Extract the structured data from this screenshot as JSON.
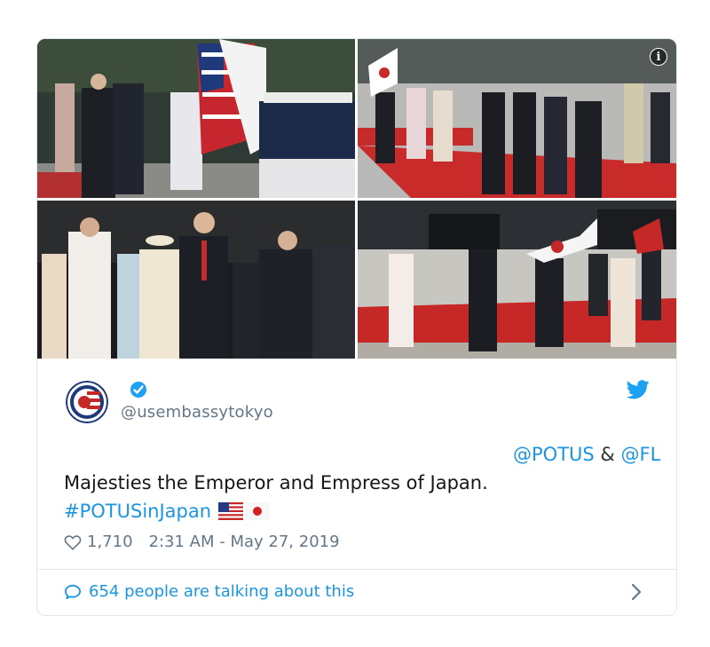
{
  "tweet": {
    "author": {
      "handle": "@usembassytokyo",
      "avatar_icon": "us-japan-seal-icon",
      "verified_icon": "verified-badge-icon"
    },
    "brand_icon": "twitter-bird-icon",
    "photos": [
      {
        "icon": "photo-military-salute"
      },
      {
        "icon": "photo-red-carpet-walk"
      },
      {
        "icon": "photo-group-walking"
      },
      {
        "icon": "photo-ceremony-flags"
      }
    ],
    "info_label": "i",
    "mentions": {
      "potus": "@POTUS",
      "amp": "&",
      "flotus": "@FL"
    },
    "text": "Majesties the Emperor and Empress of Japan.",
    "hashtag": "#POTUSinJapan",
    "flags": [
      "us-flag-icon",
      "japan-flag-icon"
    ],
    "likes": "1,710",
    "timestamp": "2:31 AM - May 27, 2019",
    "talking": "654 people are talking about this"
  },
  "colors": {
    "link": "#1b95e0",
    "text": "#14171a",
    "muted": "#657786",
    "border": "#e1e8ed"
  }
}
